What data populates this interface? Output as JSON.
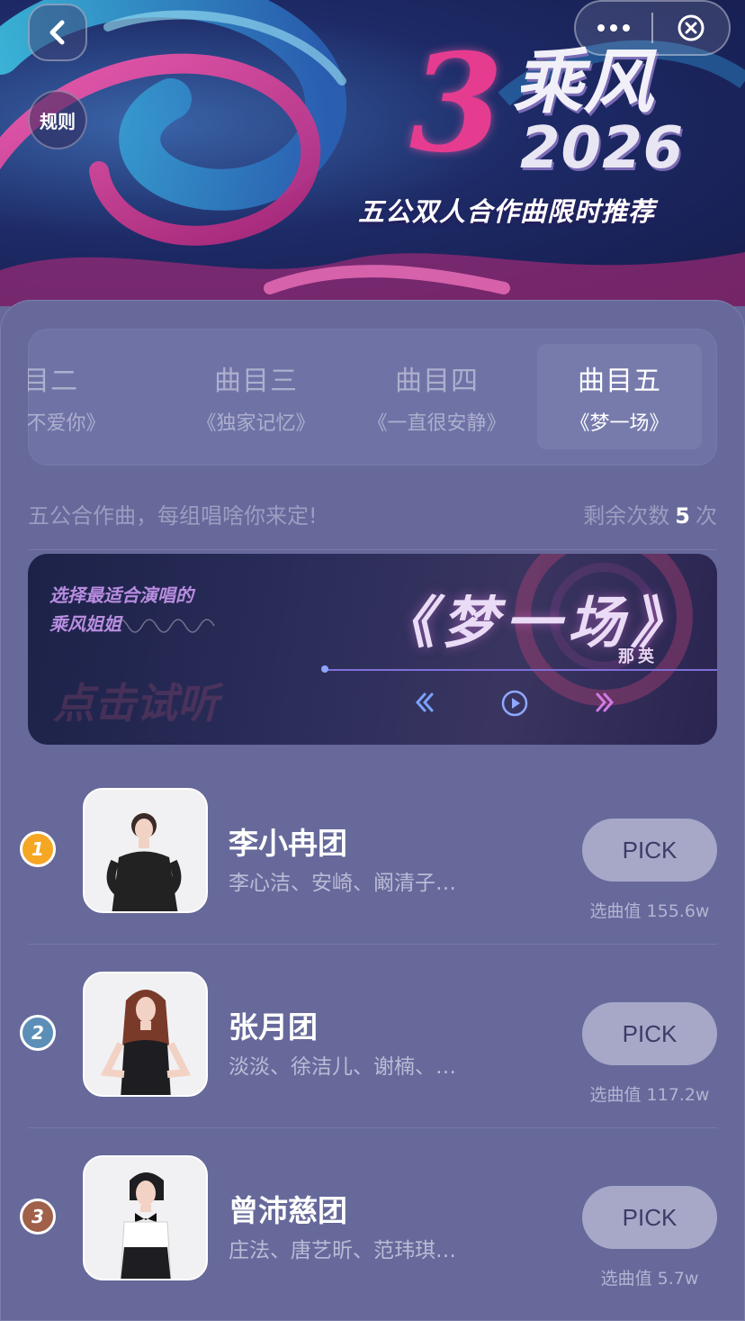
{
  "nav": {
    "back_icon": "chevron-left-icon",
    "rules_label": "规则",
    "more_icon": "more-dots-icon",
    "close_icon": "close-circle-icon"
  },
  "banner": {
    "logo_glyph": "3",
    "logo_title": "乘风",
    "logo_year": "2026",
    "subtitle": "五公双人合作曲限时推荐"
  },
  "tabs": [
    {
      "title": "曲目二",
      "song": "《说我不爱你》",
      "active": false
    },
    {
      "title": "曲目三",
      "song": "《独家记忆》",
      "active": false
    },
    {
      "title": "曲目四",
      "song": "《一直很安静》",
      "active": false
    },
    {
      "title": "曲目五",
      "song": "《梦一场》",
      "active": true
    }
  ],
  "info": {
    "slogan": "五公合作曲，每组唱啥你来定!",
    "remaining_prefix": "剩余次数",
    "remaining_count": "5",
    "remaining_suffix": "次"
  },
  "song_card": {
    "slogan_line1": "选择最适合演唱的",
    "slogan_line2": "乘风姐姐",
    "watermark": "点击试听",
    "song_title": "《梦一场》",
    "singer": "那英",
    "controls": [
      "rewind-icon",
      "play-icon",
      "forward-icon"
    ]
  },
  "teams": [
    {
      "rank": "1",
      "name": "李小冉团",
      "members": "李心洁、安崎、阚清子…",
      "pick_label": "PICK",
      "votes": "选曲值 155.6w",
      "rank_color": "#f5a623"
    },
    {
      "rank": "2",
      "name": "张月团",
      "members": "淡淡、徐洁儿、谢楠、…",
      "pick_label": "PICK",
      "votes": "选曲值 117.2w",
      "rank_color": "#5b8fb8"
    },
    {
      "rank": "3",
      "name": "曾沛慈团",
      "members": "庄法、唐艺昕、范玮琪…",
      "pick_label": "PICK",
      "votes": "选曲值 5.7w",
      "rank_color": "#a0604a"
    }
  ],
  "colors": {
    "background": "#66699a",
    "pick_button": "#a7a7c7",
    "accent_pink": "#e63c8f"
  }
}
